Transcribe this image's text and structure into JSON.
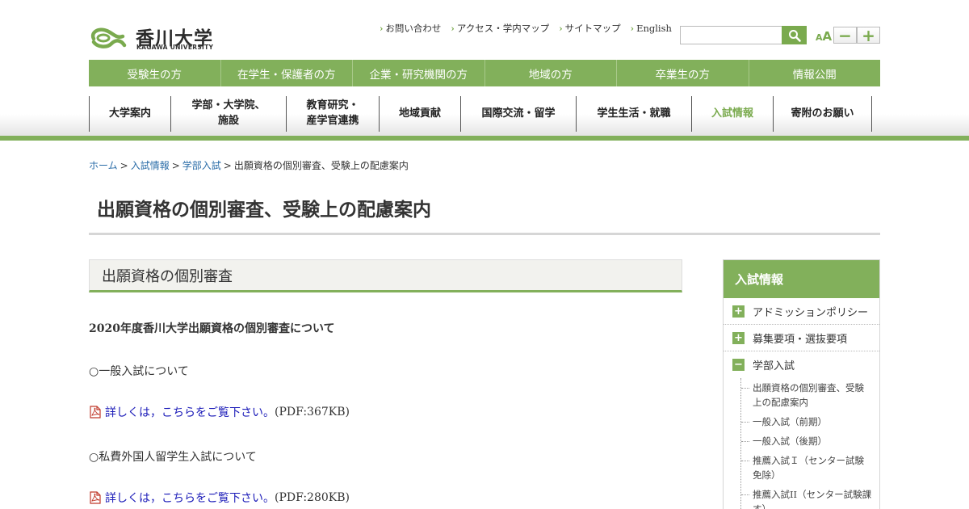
{
  "header": {
    "logo_jp": "香川大学",
    "logo_en": "KAGAWA UNIVERSITY",
    "util_links": [
      "お問い合わせ",
      "アクセス・学内マップ",
      "サイトマップ",
      "English"
    ],
    "search_placeholder": "",
    "font_size_label_small": "A",
    "font_size_label_big": "A",
    "font_minus": "−",
    "font_plus": "+"
  },
  "green_nav": [
    "受験生の方",
    "在学生・保護者の方",
    "企業・研究機関の方",
    "地域の方",
    "卒業生の方",
    "情報公開"
  ],
  "main_nav": [
    {
      "label": "大学案内",
      "width": 101
    },
    {
      "label": "学部・大学院、施設",
      "width": 143
    },
    {
      "label": "教育研究・産学官連携",
      "width": 115
    },
    {
      "label": "地域貢献",
      "width": 101
    },
    {
      "label": "国際交流・留学",
      "width": 143
    },
    {
      "label": "学生生活・就職",
      "width": 143
    },
    {
      "label": "入試情報",
      "width": 101
    },
    {
      "label": "寄附のお願い",
      "width": 123
    }
  ],
  "breadcrumb": {
    "home": "ホーム",
    "level1": "入試情報",
    "level2": "学部入試",
    "current": "出願資格の個別審査、受験上の配慮案内",
    "separator": ">"
  },
  "page_title": "出願資格の個別審査、受験上の配慮案内",
  "section_title": "出願資格の個別審査",
  "content": {
    "lead": "2020年度香川大学出願資格の個別審査について",
    "general_heading": "○一般入試について",
    "general_link": "詳しくは，こちらをご覧下さい。",
    "general_size": "(PDF:367KB)",
    "foreign_heading": "○私費外国人留学生入試について",
    "foreign_link": "詳しくは，こちらをご覧下さい。",
    "foreign_size": "(PDF:280KB)"
  },
  "sidebar": {
    "title": "入試情報",
    "items": [
      {
        "label": "アドミッションポリシー",
        "toggle": "+"
      },
      {
        "label": "募集要項・選抜要項",
        "toggle": "+"
      },
      {
        "label": "学部入試",
        "toggle": "−"
      }
    ],
    "sub_items": [
      "出願資格の個別審査、受験上の配慮案内",
      "一般入試（前期）",
      "一般入試（後期）",
      "推薦入試Ｉ（センター試験免除）",
      "推薦入試II（センター試験課す）"
    ]
  },
  "colors": {
    "accent": "#82b05b",
    "link": "#2b6da8",
    "pdf_link": "#1a1ab8"
  }
}
